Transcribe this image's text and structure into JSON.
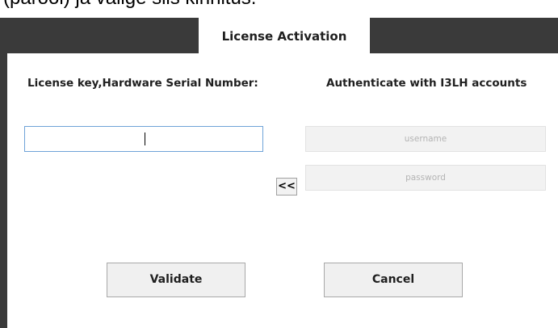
{
  "caption": {
    "text": "(parool) ja valige siis kinnitus."
  },
  "window": {
    "tab_title": "License Activation"
  },
  "left_section": {
    "heading": "License key,Hardware Serial Number:",
    "license_input_value": ""
  },
  "right_section": {
    "heading": "Authenticate with I3LH accounts",
    "username_placeholder": "username",
    "password_placeholder": "password"
  },
  "buttons": {
    "transfer_label": "<<",
    "validate_label": "Validate",
    "cancel_label": "Cancel"
  },
  "colors": {
    "frame": "#3a3a3a",
    "input_focus_border": "#6fa3d8",
    "disabled_field": "#f2f2f2"
  }
}
